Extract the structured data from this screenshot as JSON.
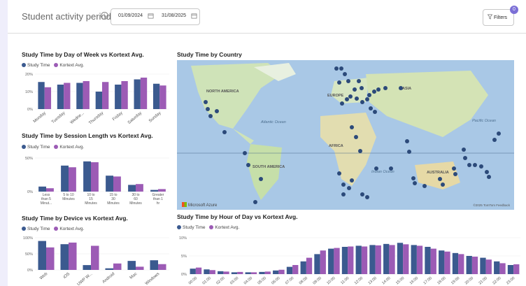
{
  "header": {
    "period_label": "Student activity period",
    "date_from": "01/09/2024",
    "date_to": "31/08/2025",
    "filters_label": "Filters",
    "filters_badge": "0"
  },
  "legend": {
    "study_time": "Study Time",
    "kortext_avg": "Kortext Avg."
  },
  "colors": {
    "study_time": "#3b5a8f",
    "kortext_avg": "#9c5bb5",
    "accent": "#7b6fd6"
  },
  "icons": [
    "info-icon",
    "calendar-icon",
    "filter-icon"
  ],
  "map": {
    "title": "Study Time by Country",
    "labels": {
      "north_america": "NORTH AMERICA",
      "europe": "EUROPE",
      "asia": "ASIA",
      "africa": "AFRICA",
      "south_america": "SOUTH AMERICA",
      "australia": "AUSTRALIA",
      "atlantic": "Atlantic Ocean",
      "pacific": "Pacific Ocean",
      "indian": "Indian Ocean"
    },
    "attribution_left": "Microsoft Azure",
    "attribution_right": "©2025 TomTom Feedback"
  },
  "chart_data": [
    {
      "type": "bar",
      "title": "Study Time by Day of Week vs Kortext Avg.",
      "categories": [
        "Monday",
        "Tuesday",
        "Wedne...",
        "Thursday",
        "Friday",
        "Saturday",
        "Sunday"
      ],
      "series": [
        {
          "name": "Study Time",
          "values": [
            15.5,
            14,
            15,
            10,
            14,
            17,
            14.5
          ]
        },
        {
          "name": "Kortext Avg.",
          "values": [
            12.5,
            15,
            16,
            15.5,
            16,
            18,
            13.5
          ]
        }
      ],
      "yticks": [
        "20%",
        "10%",
        "0%"
      ],
      "ylim": [
        0,
        20
      ]
    },
    {
      "type": "bar",
      "title": "Study Time by Session Length vs Kortext Avg.",
      "categories": [
        "Less than 5 Minut...",
        "5 to 10 Minutes",
        "10 to 15 Minutes",
        "15 to 30 Minutes",
        "30 to 60 Minutes",
        "Greater than 1 hr"
      ],
      "series": [
        {
          "name": "Study Time",
          "values": [
            12,
            62,
            72,
            38,
            16,
            4
          ]
        },
        {
          "name": "Kortext Avg.",
          "values": [
            8,
            58,
            70,
            36,
            18,
            6
          ]
        }
      ],
      "yticks": [
        "50%",
        "0%"
      ],
      "ylim": [
        0,
        80
      ]
    },
    {
      "type": "bar",
      "title": "Study Time by Device vs Kortext Avg.",
      "categories": [
        "Web",
        "iOS",
        "UWP W...",
        "Android",
        "Mac",
        "Windows"
      ],
      "series": [
        {
          "name": "Study Time",
          "values": [
            90,
            80,
            15,
            5,
            28,
            30
          ]
        },
        {
          "name": "Kortext Avg.",
          "values": [
            70,
            85,
            75,
            20,
            10,
            18
          ]
        }
      ],
      "yticks": [
        "100%",
        "50%",
        "0%"
      ],
      "ylim": [
        0,
        100
      ]
    },
    {
      "type": "bar",
      "title": "Study Time by Hour of Day vs Kortext Avg.",
      "categories": [
        "00:00",
        "01:00",
        "02:00",
        "03:00",
        "04:00",
        "05:00",
        "06:00",
        "07:00",
        "08:00",
        "09:00",
        "10:00",
        "11:00",
        "12:00",
        "13:00",
        "14:00",
        "15:00",
        "16:00",
        "17:00",
        "18:00",
        "19:00",
        "20:00",
        "21:00",
        "22:00",
        "23:00"
      ],
      "series": [
        {
          "name": "Study Time",
          "values": [
            1.5,
            1.3,
            0.8,
            0.5,
            0.5,
            0.6,
            1,
            2,
            3.5,
            5.5,
            7,
            7.5,
            7.8,
            8,
            8.3,
            8.6,
            8,
            7.5,
            6.5,
            5.8,
            5,
            4.5,
            3.5,
            2.5
          ]
        },
        {
          "name": "Kortext Avg.",
          "values": [
            1.8,
            1.1,
            0.7,
            0.6,
            0.5,
            0.7,
            1.2,
            2.5,
            4.5,
            6.5,
            7.2,
            7.6,
            7.6,
            7.9,
            8,
            8.2,
            7.8,
            7,
            6.2,
            5.5,
            4.8,
            4,
            3,
            2.7
          ]
        }
      ],
      "yticks": [
        "10%",
        "5%",
        "0%"
      ],
      "ylim": [
        0,
        10
      ]
    }
  ]
}
